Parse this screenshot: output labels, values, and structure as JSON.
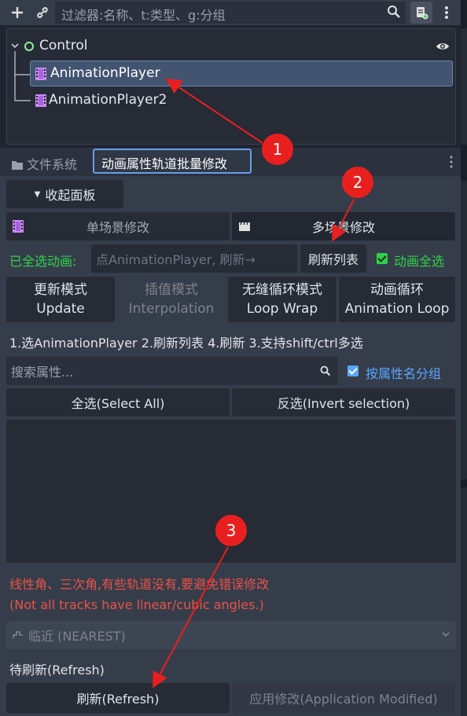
{
  "toolbar": {
    "filter_placeholder": "过滤器:名称、t:类型、g:分组",
    "icons": [
      "plus-icon",
      "link-icon",
      "search-icon",
      "script-icon",
      "kebab-menu-icon"
    ]
  },
  "scene_tree": {
    "root": "Control",
    "children": [
      "AnimationPlayer",
      "AnimationPlayer2"
    ]
  },
  "tabs": {
    "file_system": "文件系统",
    "active": "动画属性轨道批量修改"
  },
  "panel": {
    "collapse_button": "收起面板",
    "single_scene": "单场景修改",
    "multi_scene": "多场景修改",
    "selected_anim_label": "已全选动画:",
    "anim_dropdown": "点AnimationPlayer, 刷新→",
    "refresh_list": "刷新列表",
    "select_all_anims": "动画全选",
    "modes": [
      {
        "line1": "更新模式",
        "line2": "Update"
      },
      {
        "line1": "插值模式",
        "line2": "Interpolation"
      },
      {
        "line1": "无缝循环模式",
        "line2": "Loop Wrap"
      },
      {
        "line1": "动画循环",
        "line2": "Animation Loop"
      }
    ],
    "instructions": "1.选AnimationPlayer 2.刷新列表 4.刷新 3.支持shift/ctrl多选",
    "search_placeholder": "搜索属性...",
    "group_by_property": "按属性名分组",
    "select_all": "全选(Select All)",
    "invert_selection": "反选(Invert selection)",
    "warning_cn": "线性角、三次角,有些轨道没有,要避免错误修改",
    "warning_en": "(Not all tracks have linear/cubic angles.)",
    "interp_option": "临近 (NEAREST)",
    "status": "待刷新(Refresh)",
    "refresh": "刷新(Refresh)",
    "apply": "应用修改(Application Modified)"
  },
  "annotations": [
    "1",
    "2",
    "3"
  ],
  "colors": {
    "accent": "#58a7ff",
    "success": "#2fd14a",
    "warning": "#e8524a",
    "annotation": "#e81f1f"
  }
}
